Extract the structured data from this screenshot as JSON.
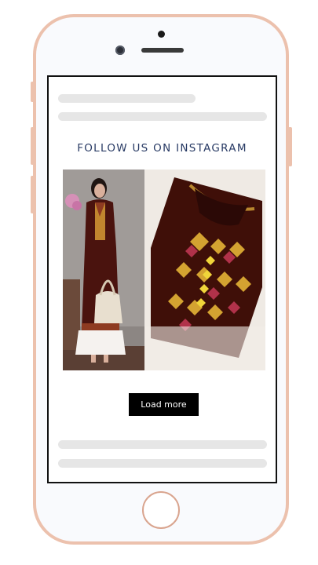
{
  "section": {
    "heading": "FOLLOW US ON INSTAGRAM",
    "load_more_label": "Load more"
  },
  "gallery": {
    "items": [
      {
        "icon": "instagram-post-woman-kurta-image"
      },
      {
        "icon": "instagram-post-embroidered-fabric-image"
      }
    ]
  },
  "colors": {
    "phone_frame": "#ecc1ad",
    "heading_text": "#283a64",
    "button_bg": "#000000",
    "placeholder": "#e6e6e6"
  }
}
